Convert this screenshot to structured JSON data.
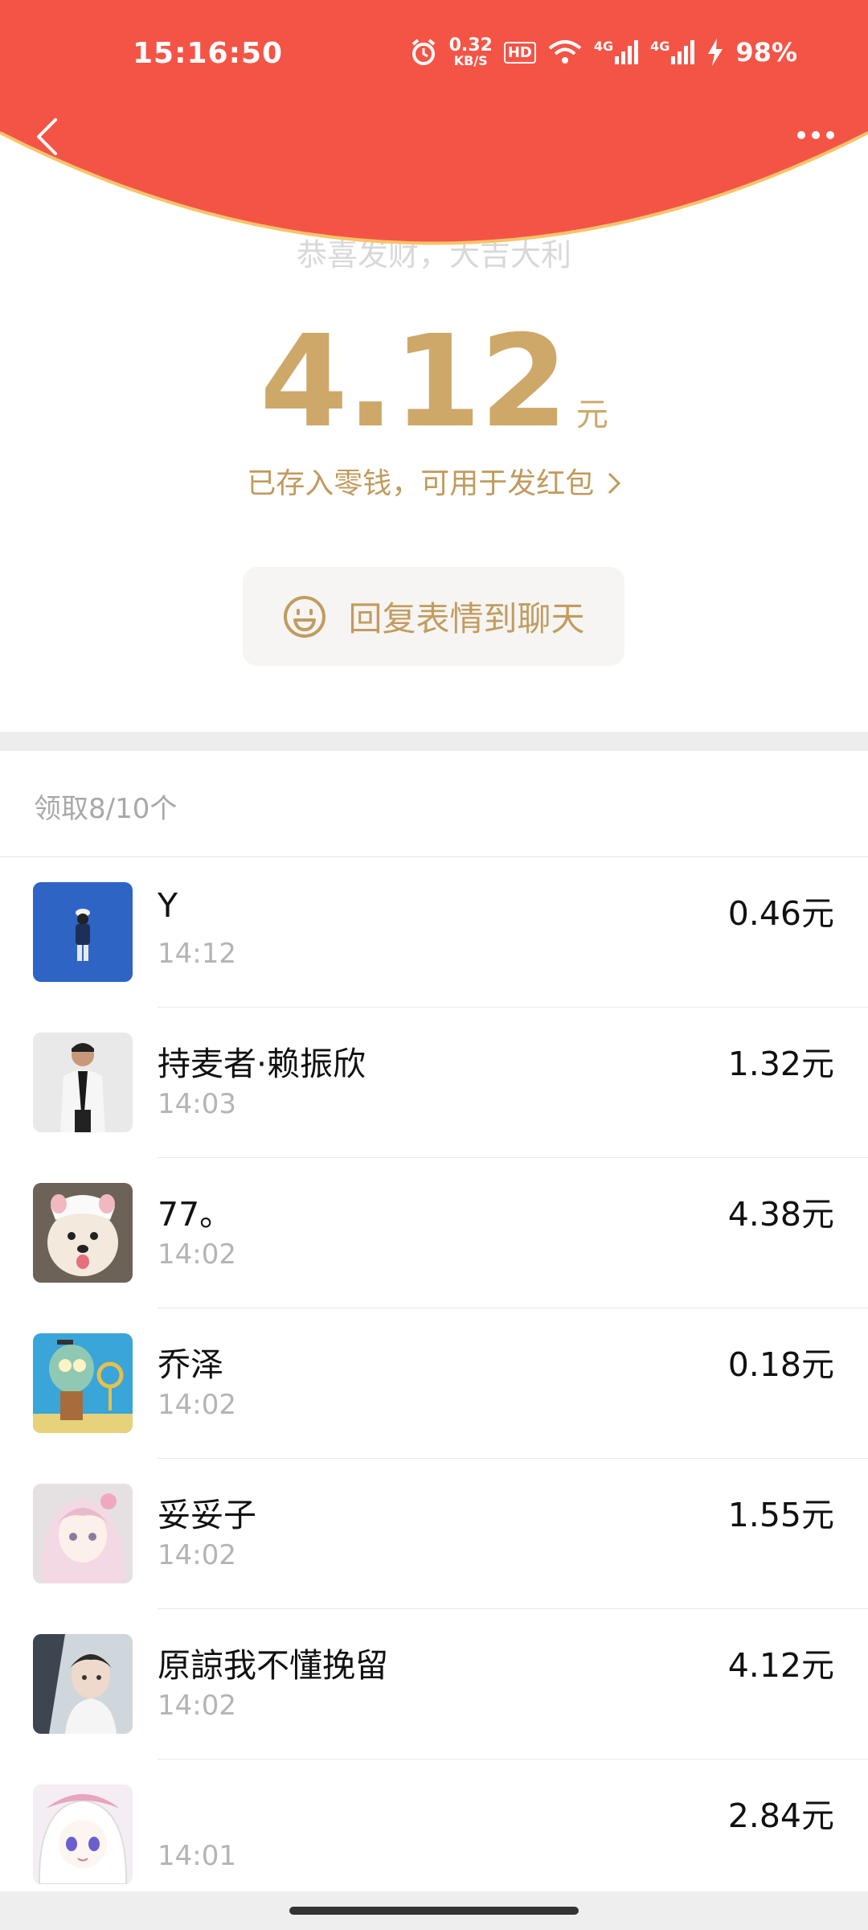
{
  "status_bar": {
    "time": "15:16:50",
    "net_speed_value": "0.32",
    "net_speed_unit": "KB/S",
    "hd_label": "HD",
    "signal_1": "4G",
    "signal_2": "4G",
    "battery": "98%"
  },
  "header": {
    "background_color": "#f45446",
    "edge_color": "#f7c36a",
    "faded_line": "恭喜发财，大吉大利"
  },
  "received": {
    "amount": "4.12",
    "unit": "元",
    "note": "已存入零钱，可用于发红包"
  },
  "reply_button": {
    "label": "回复表情到聊天",
    "icon": "smile-icon"
  },
  "summary": "领取8/10个",
  "recipients": [
    {
      "name": "Y",
      "time": "14:12",
      "amount": "0.46元",
      "avatar": "avatar-blue-figure"
    },
    {
      "name": "持麦者·赖振欣",
      "time": "14:03",
      "amount": "1.32元",
      "avatar": "avatar-man-white-jacket"
    },
    {
      "name": "77。",
      "time": "14:02",
      "amount": "4.38元",
      "avatar": "avatar-puppy"
    },
    {
      "name": "乔泽",
      "time": "14:02",
      "amount": "0.18元",
      "avatar": "avatar-squidward"
    },
    {
      "name": "妥妥子",
      "time": "14:02",
      "amount": "1.55元",
      "avatar": "avatar-anime-girl-pink"
    },
    {
      "name": "原諒我不懂挽留",
      "time": "14:02",
      "amount": "4.12元",
      "avatar": "avatar-boy-car"
    },
    {
      "name": "",
      "time": "14:01",
      "amount": "2.84元",
      "avatar": "avatar-anime-white-hair"
    }
  ]
}
